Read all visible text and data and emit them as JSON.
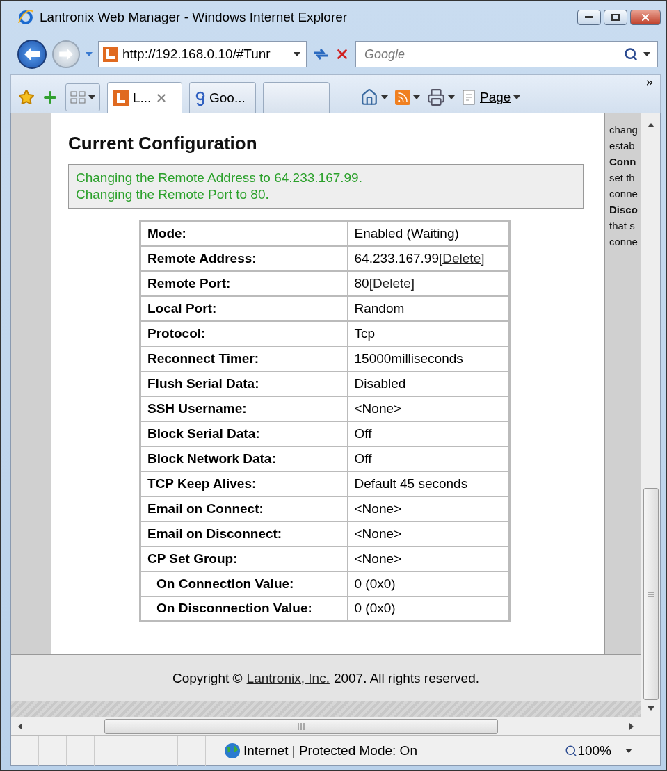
{
  "window": {
    "title": "Lantronix Web Manager - Windows Internet Explorer"
  },
  "nav": {
    "address": "http://192.168.0.10/#Tunr",
    "search_placeholder": "Google"
  },
  "tabs": [
    {
      "label": "L...",
      "selected": true,
      "kind": "site"
    },
    {
      "label": "Goo...",
      "selected": false,
      "kind": "google"
    },
    {
      "selected": false,
      "kind": "blank"
    }
  ],
  "toolbar": {
    "page_menu": "Page"
  },
  "page": {
    "heading": "Current Configuration",
    "messages": [
      "Changing the Remote Address to 64.233.167.99.",
      "Changing the Remote Port to 80."
    ],
    "rows": [
      {
        "label": "Mode:",
        "value": "Enabled (Waiting)",
        "kind": "main"
      },
      {
        "label": "Remote Address:",
        "value": "64.233.167.99",
        "link": "[Delete]",
        "kind": "main"
      },
      {
        "label": "Remote Port:",
        "value": "80",
        "link": "[Delete]",
        "kind": "main"
      },
      {
        "label": "Local Port:",
        "value": "Random",
        "kind": "main"
      },
      {
        "label": "Protocol:",
        "value": "Tcp",
        "kind": "main"
      },
      {
        "label": "Reconnect Timer:",
        "value": "15000milliseconds",
        "kind": "main"
      },
      {
        "label": "Flush Serial Data:",
        "value": "Disabled",
        "kind": "main"
      },
      {
        "label": "SSH Username:",
        "value": "<None>",
        "kind": "main"
      },
      {
        "label": "Block Serial Data:",
        "value": "Off",
        "kind": "main"
      },
      {
        "label": "Block Network Data:",
        "value": "Off",
        "kind": "main"
      },
      {
        "label": "TCP Keep Alives:",
        "value": "Default 45 seconds",
        "kind": "main"
      },
      {
        "label": "Email on Connect:",
        "value": "<None>",
        "kind": "main"
      },
      {
        "label": "Email on Disconnect:",
        "value": "<None>",
        "kind": "main"
      },
      {
        "label": "CP Set Group:",
        "value": "<None>",
        "kind": "main"
      },
      {
        "label": "On Connection Value:",
        "value": "0 (0x0)",
        "kind": "sub"
      },
      {
        "label": "On Disconnection Value:",
        "value": "0 (0x0)",
        "kind": "sub"
      }
    ],
    "help_lines": [
      {
        "text": "chang",
        "bold": false
      },
      {
        "text": "estab",
        "bold": false
      },
      {
        "text": "Conn",
        "bold": true
      },
      {
        "text": "set th",
        "bold": false
      },
      {
        "text": "conne",
        "bold": false
      },
      {
        "text": "Disco",
        "bold": true
      },
      {
        "text": "that s",
        "bold": false
      },
      {
        "text": "conne",
        "bold": false
      }
    ],
    "footer": {
      "before": "Copyright ©",
      "link": "Lantronix, Inc.",
      "after": "2007. All rights reserved."
    }
  },
  "status": {
    "zone": "Internet | Protected Mode: On",
    "zoom": "100%"
  }
}
